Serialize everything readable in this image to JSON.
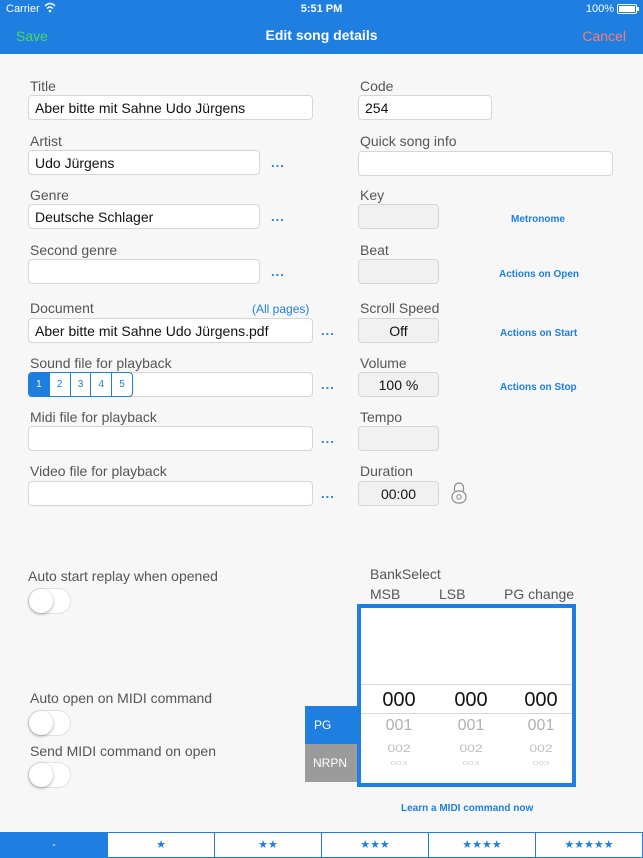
{
  "status": {
    "carrier": "Carrier",
    "time": "5:51 PM",
    "battery": "100%"
  },
  "nav": {
    "save": "Save",
    "title": "Edit song details",
    "cancel": "Cancel"
  },
  "left": {
    "title_label": "Title",
    "title_value": "Aber bitte mit Sahne Udo Jürgens",
    "artist_label": "Artist",
    "artist_value": "Udo Jürgens",
    "genre_label": "Genre",
    "genre_value": "Deutsche Schlager",
    "second_genre_label": "Second genre",
    "second_genre_value": "",
    "document_label": "Document",
    "all_pages": "(All pages)",
    "document_value": "Aber bitte mit Sahne Udo Jürgens.pdf",
    "sound_label": "Sound file for playback",
    "sound_tabs": [
      "1",
      "2",
      "3",
      "4",
      "5"
    ],
    "midi_label": "Midi file for playback",
    "midi_value": "",
    "video_label": "Video file for playback",
    "video_value": "",
    "more": "..."
  },
  "right": {
    "code_label": "Code",
    "code_value": "254",
    "quick_label": "Quick song info",
    "quick_value": "",
    "key_label": "Key",
    "key_value": "",
    "beat_label": "Beat",
    "beat_value": "",
    "scroll_label": "Scroll Speed",
    "scroll_value": "Off",
    "volume_label": "Volume",
    "volume_value": "100 %",
    "tempo_label": "Tempo",
    "tempo_value": "",
    "duration_label": "Duration",
    "duration_value": "00:00",
    "metronome": "Metronome",
    "actions_open": "Actions on Open",
    "actions_start": "Actions on Start",
    "actions_stop": "Actions on Stop"
  },
  "toggles": {
    "auto_start": {
      "label": "Auto start replay when opened",
      "on": false
    },
    "auto_open_midi": {
      "label": "Auto open on MIDI command",
      "on": false
    },
    "send_midi": {
      "label": "Send MIDI command on open",
      "on": false
    }
  },
  "midi": {
    "bankselect": "BankSelect",
    "msb": "MSB",
    "lsb": "LSB",
    "pg_change": "PG change",
    "selected": [
      "000",
      "000",
      "000"
    ],
    "next1": [
      "001",
      "001",
      "001"
    ],
    "next2": [
      "002",
      "002",
      "002"
    ],
    "next3": [
      "003",
      "003",
      "003"
    ],
    "pg": "PG",
    "nrpn": "NRPN",
    "learn": "Learn a MIDI command now"
  },
  "rating": [
    "-",
    "★",
    "★★",
    "★★★",
    "★★★★",
    "★★★★★"
  ],
  "colors": {
    "accent": "#1e7fe0",
    "save": "#4cd964",
    "cancel": "#ff7c6e"
  }
}
